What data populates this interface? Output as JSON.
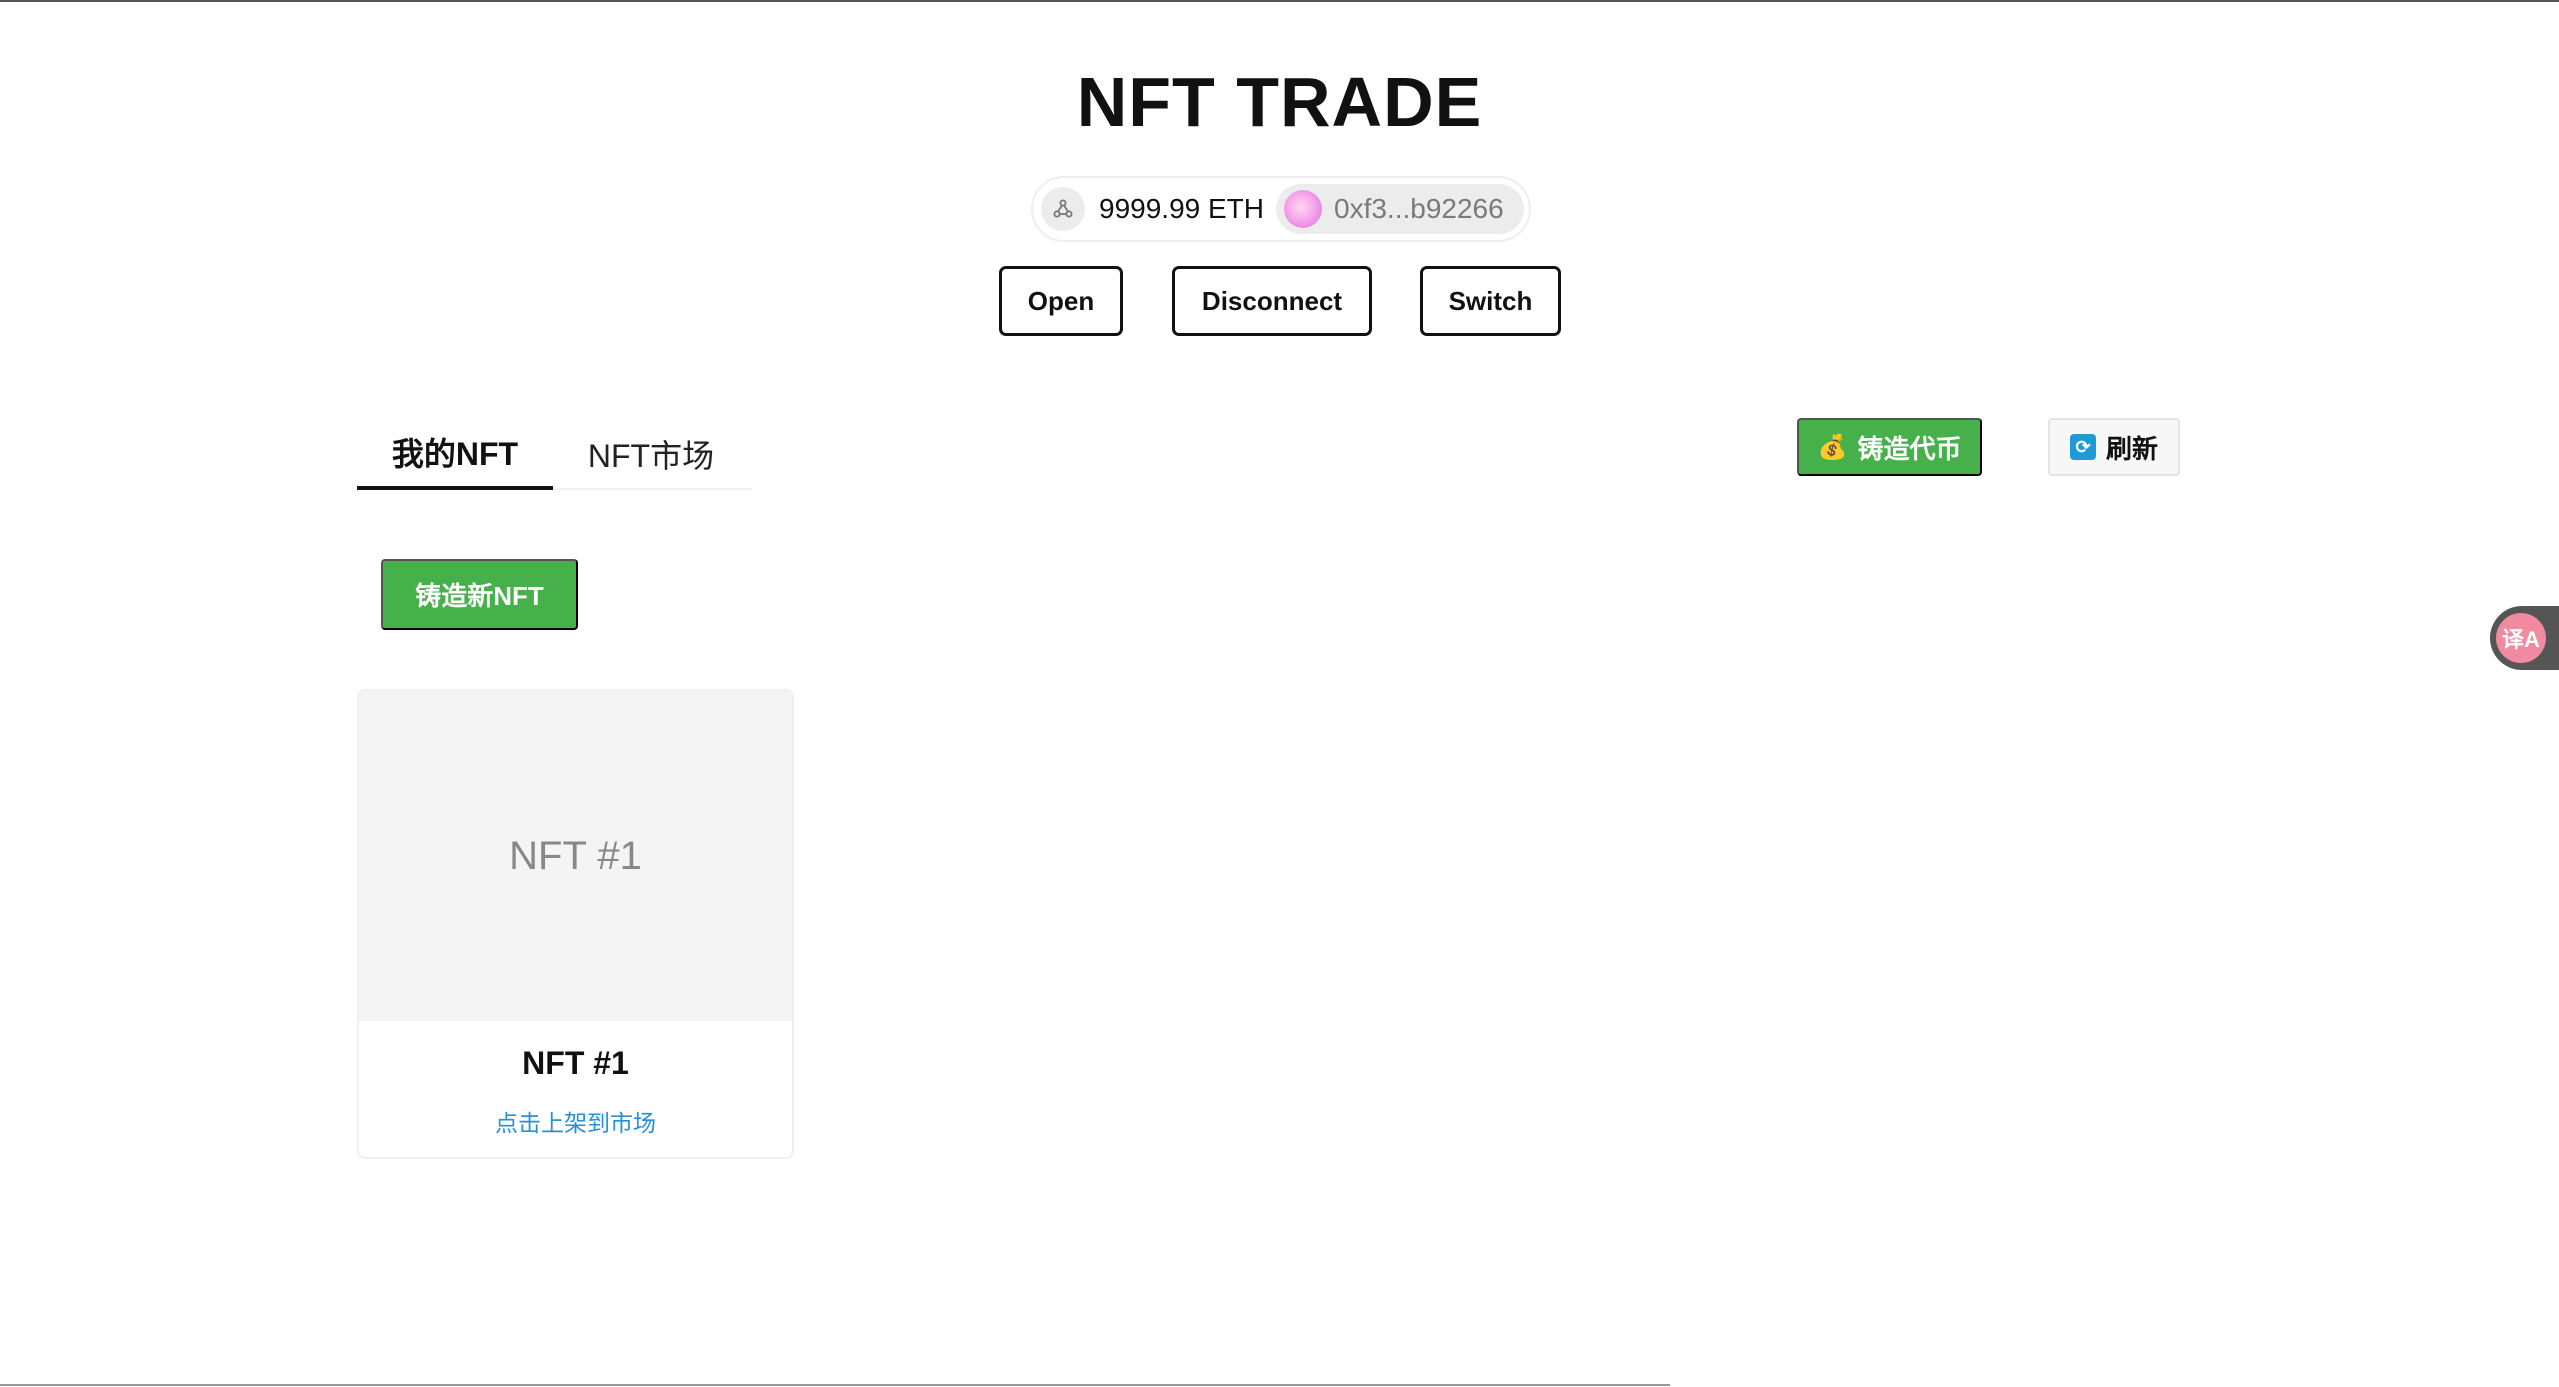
{
  "app": {
    "title": "NFT TRADE"
  },
  "wallet": {
    "network_icon": "network-icon",
    "balance": "9999.99 ETH",
    "address": "0xf3...b92266"
  },
  "wallet_actions": {
    "open_label": "Open",
    "disconnect_label": "Disconnect",
    "switch_label": "Switch"
  },
  "tabs": [
    {
      "label": "我的NFT",
      "active": true
    },
    {
      "label": "NFT市场",
      "active": false
    }
  ],
  "toolbar": {
    "mint_token_icon": "money-bag-icon",
    "mint_token_label": "铸造代币",
    "refresh_icon": "refresh-icon",
    "refresh_label": "刷新"
  },
  "mint_nft_label": "铸造新NFT",
  "nfts": [
    {
      "image_text": "NFT #1",
      "title": "NFT #1",
      "action": "点击上架到市场"
    }
  ],
  "translate_widget": {
    "icon": "translate-icon",
    "glyph": "译A"
  },
  "colors": {
    "accent_green": "#46b04b",
    "link_blue": "#2a8fd6",
    "refresh_blue": "#1e9bd7"
  }
}
